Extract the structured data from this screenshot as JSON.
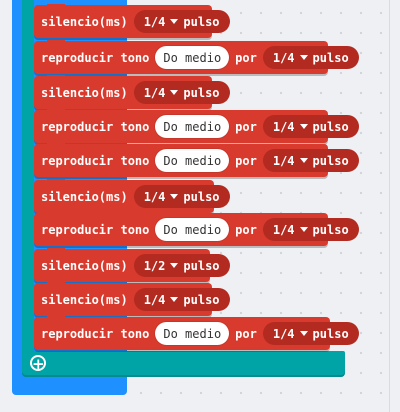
{
  "blocks": [
    {
      "type": "rest",
      "label": "silencio(ms)",
      "beat": "1/4",
      "unit": "pulso"
    },
    {
      "type": "tone",
      "label": "reproducir tono",
      "note": "Do medio",
      "por": "por",
      "beat": "1/4",
      "unit": "pulso"
    },
    {
      "type": "rest",
      "label": "silencio(ms)",
      "beat": "1/4",
      "unit": "pulso"
    },
    {
      "type": "tone",
      "label": "reproducir tono",
      "note": "Do medio",
      "por": "por",
      "beat": "1/4",
      "unit": "pulso"
    },
    {
      "type": "tone",
      "label": "reproducir tono",
      "note": "Do medio",
      "por": "por",
      "beat": "1/4",
      "unit": "pulso"
    },
    {
      "type": "rest",
      "label": "silencio(ms)",
      "beat": "1/4",
      "unit": "pulso"
    },
    {
      "type": "tone",
      "label": "reproducir tono",
      "note": "Do medio",
      "por": "por",
      "beat": "1/4",
      "unit": "pulso"
    },
    {
      "type": "rest",
      "label": "silencio(ms)",
      "beat": "1/2",
      "unit": "pulso"
    },
    {
      "type": "rest",
      "label": "silencio(ms)",
      "beat": "1/4",
      "unit": "pulso"
    },
    {
      "type": "tone",
      "label": "reproducir tono",
      "note": "Do medio",
      "por": "por",
      "beat": "1/4",
      "unit": "pulso"
    }
  ],
  "add_button": {
    "icon": "plus-circle-icon",
    "symbol": "+"
  },
  "colors": {
    "music_block": "#d83b2e",
    "dropdown": "#b32a20",
    "loop": "#00a4a6",
    "event": "#1e90ff",
    "canvas": "#eef0f3"
  }
}
